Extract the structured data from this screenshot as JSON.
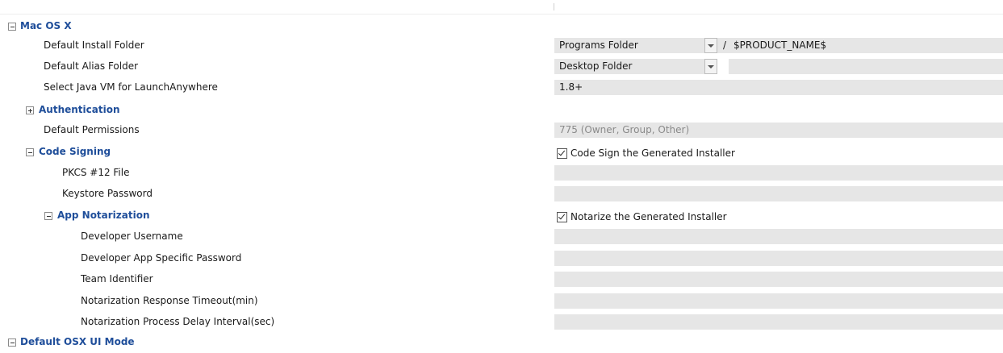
{
  "tree": {
    "macos": "Mac OS X",
    "default_install_folder": {
      "label": "Default Install Folder",
      "select": "Programs Folder",
      "separator": "/",
      "value": "$PRODUCT_NAME$"
    },
    "default_alias_folder": {
      "label": "Default Alias Folder",
      "select": "Desktop Folder",
      "separator": "/",
      "value": ""
    },
    "java_vm": {
      "label": "Select Java VM for LaunchAnywhere",
      "value": "1.8+"
    },
    "authentication": "Authentication",
    "default_permissions": {
      "label": "Default Permissions",
      "value": "775 (Owner, Group, Other)"
    },
    "code_signing": {
      "label": "Code Signing",
      "checkbox_label": "Code Sign the Generated Installer",
      "checked": true
    },
    "pkcs_file": {
      "label": "PKCS #12 File",
      "value": ""
    },
    "keystore_password": {
      "label": "Keystore Password",
      "value": ""
    },
    "app_notarization": {
      "label": "App Notarization",
      "checkbox_label": "Notarize the Generated Installer",
      "checked": true
    },
    "developer_username": {
      "label": "Developer Username",
      "value": ""
    },
    "developer_app_password": {
      "label": "Developer App Specific Password",
      "value": ""
    },
    "team_identifier": {
      "label": "Team Identifier",
      "value": ""
    },
    "notarization_timeout": {
      "label": "Notarization Response Timeout(min)",
      "value": ""
    },
    "notarization_delay": {
      "label": "Notarization Process Delay Interval(sec)",
      "value": ""
    },
    "default_osx_ui_mode": "Default OSX UI Mode"
  }
}
